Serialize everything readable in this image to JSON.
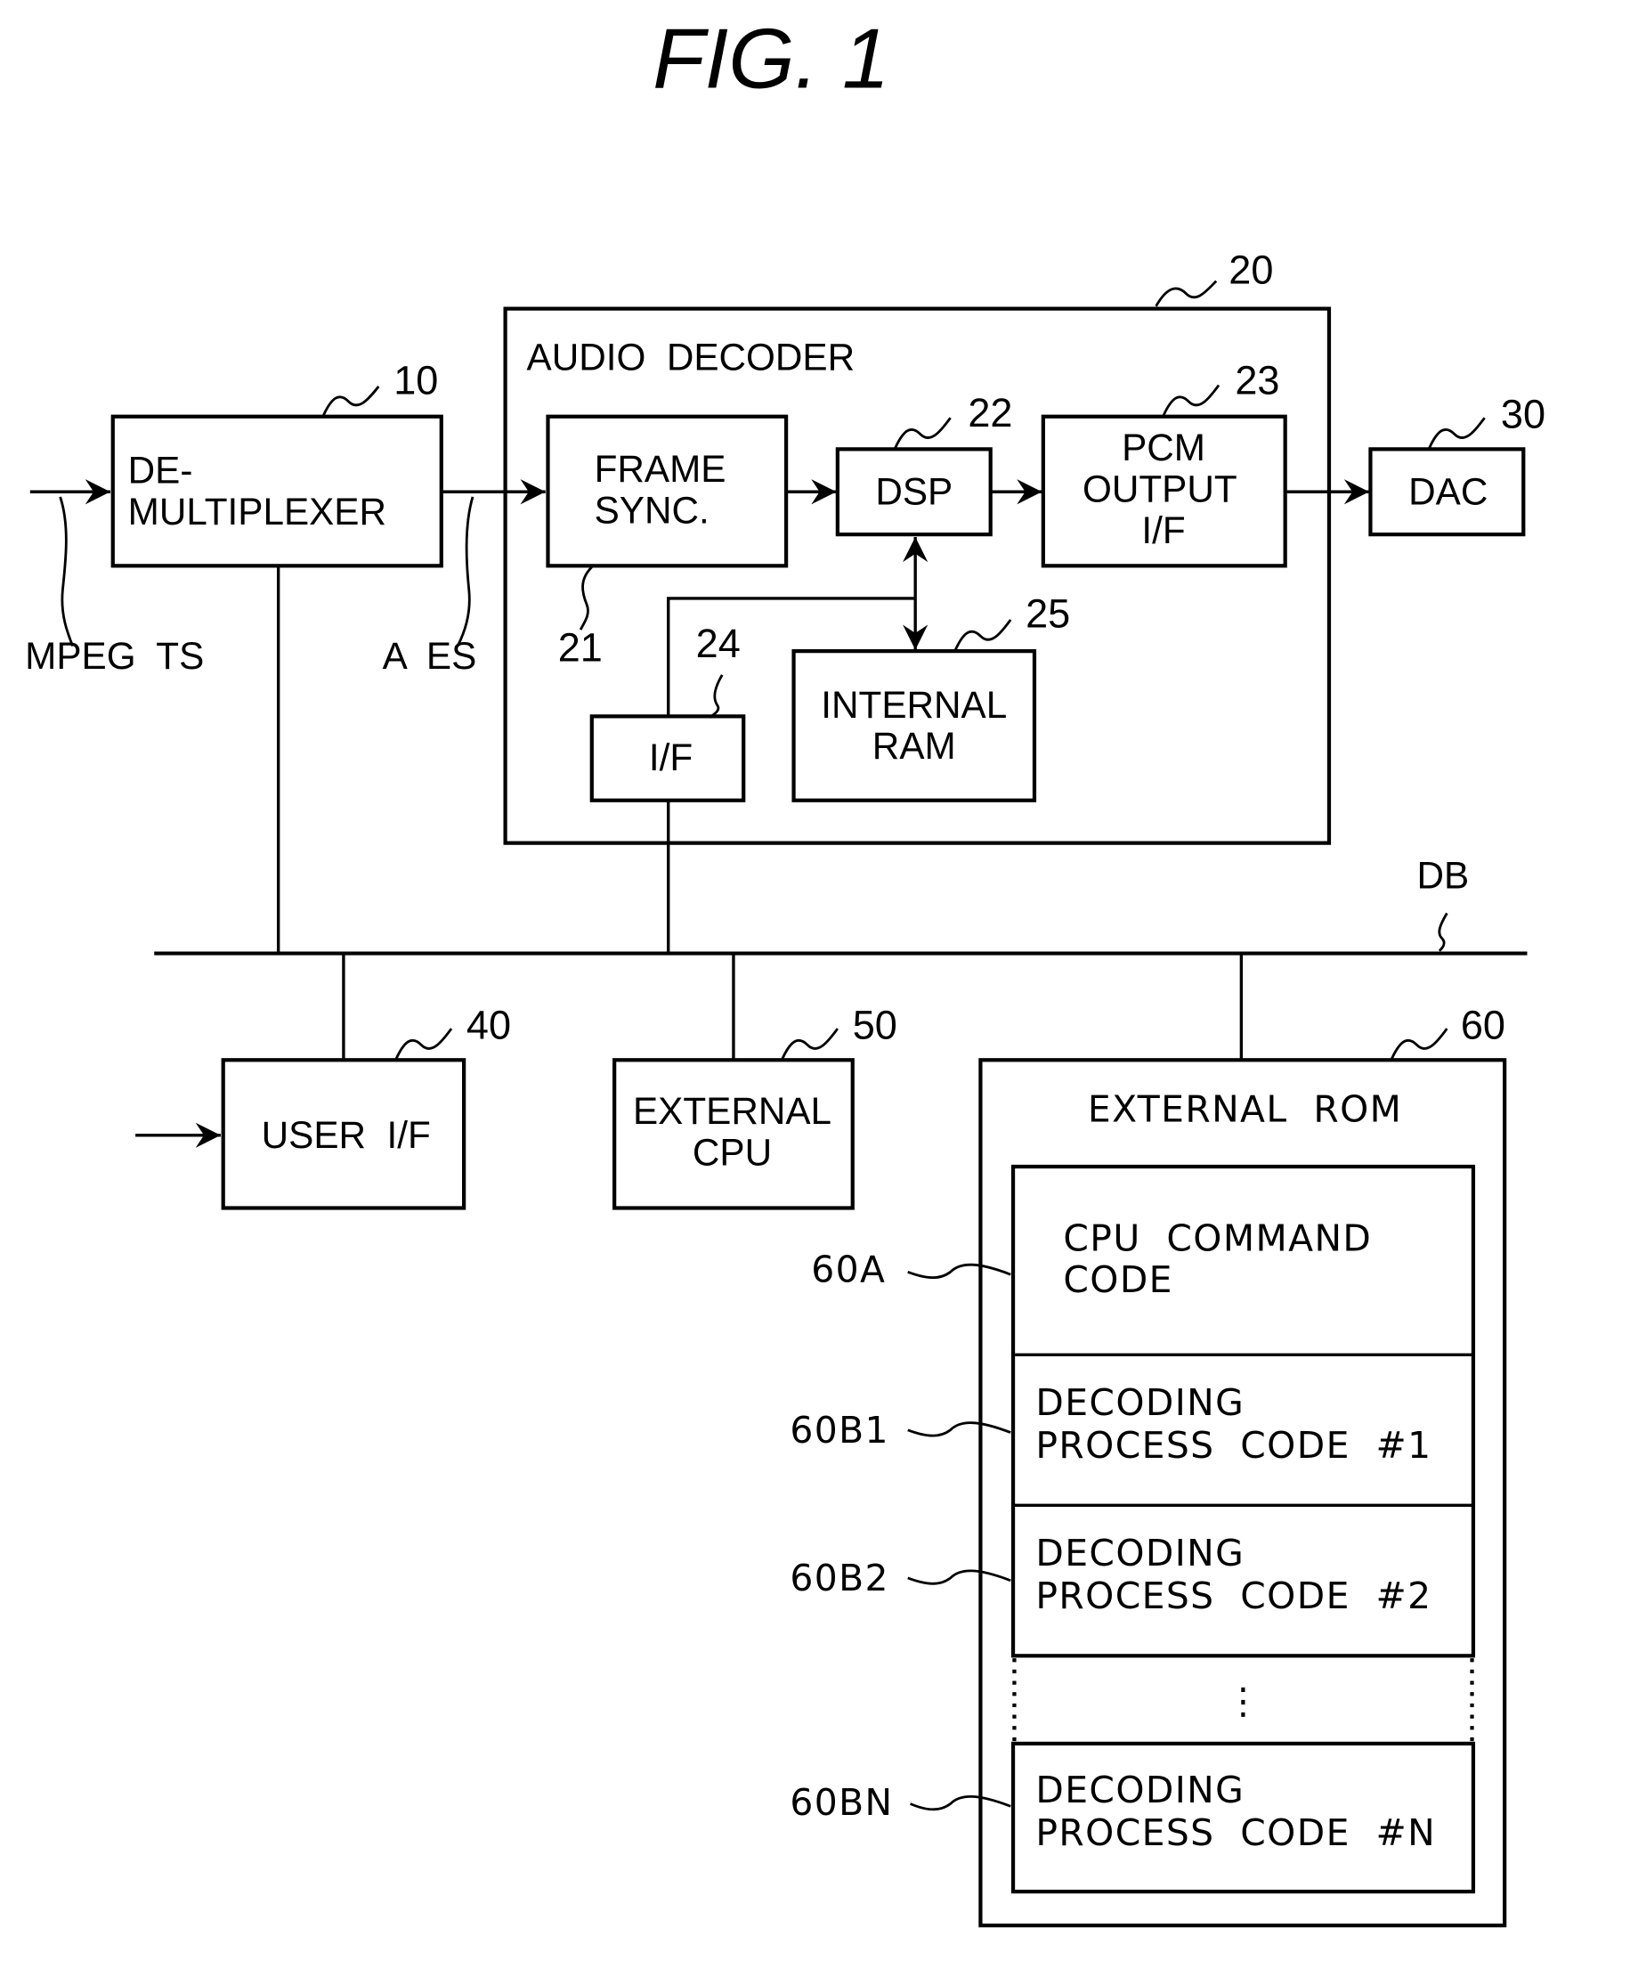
{
  "figure": {
    "title": "FIG. 1"
  },
  "blocks": {
    "demux": {
      "ref": "10",
      "line1": "DE-",
      "line2": "MULTIPLEXER"
    },
    "audio_decoder": {
      "ref": "20",
      "label": "AUDIO  DECODER"
    },
    "frame_sync": {
      "ref": "21",
      "line1": "FRAME",
      "line2": "SYNC."
    },
    "dsp": {
      "ref": "22",
      "label": "DSP"
    },
    "pcm_output": {
      "ref": "23",
      "line1": "PCM",
      "line2": "OUTPUT",
      "line3": "I/F"
    },
    "interface": {
      "ref": "24",
      "label": "I/F"
    },
    "internal_ram": {
      "ref": "25",
      "line1": "INTERNAL",
      "line2": "RAM"
    },
    "dac": {
      "ref": "30",
      "label": "DAC"
    },
    "user_if": {
      "ref": "40",
      "label": "USER  I/F"
    },
    "external_cpu": {
      "ref": "50",
      "line1": "EXTERNAL",
      "line2": "CPU"
    },
    "external_rom": {
      "ref": "60",
      "label": "EXTERNAL  ROM",
      "sections": [
        {
          "ref": "60A",
          "line1": "CPU  COMMAND",
          "line2": "CODE"
        },
        {
          "ref": "60B1",
          "line1": "DECODING",
          "line2": "PROCESS  CODE  #1"
        },
        {
          "ref": "60B2",
          "line1": "DECODING",
          "line2": "PROCESS  CODE  #2"
        },
        {
          "ref": "60BN",
          "line1": "DECODING",
          "line2": "PROCESS  CODE  #N"
        }
      ],
      "ellipsis": "⋮"
    }
  },
  "signals": {
    "input": "MPEG  TS",
    "audio_es": "A  ES",
    "data_bus": "DB"
  }
}
